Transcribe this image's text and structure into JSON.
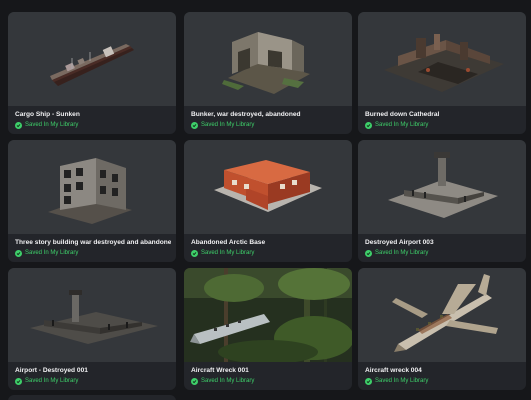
{
  "library": {
    "status_label": "Saved In My Library",
    "status_color": "#3ecf6a",
    "items": [
      {
        "title": "Cargo Ship - Sunken",
        "icon": "cargo-ship-model"
      },
      {
        "title": "Bunker, war destroyed, abandoned",
        "icon": "bunker-ruin-model"
      },
      {
        "title": "Burned down Cathedral",
        "icon": "cathedral-ruin-model"
      },
      {
        "title": "Three story building war destroyed and abandoned",
        "icon": "ruined-building-model"
      },
      {
        "title": "Abandoned Arctic Base",
        "icon": "arctic-base-model"
      },
      {
        "title": "Destroyed Airport 003",
        "icon": "airport-ruin-model"
      },
      {
        "title": "Airport - Destroyed 001",
        "icon": "airport-ruin-model"
      },
      {
        "title": "Aircraft Wreck 001",
        "icon": "aircraft-wreck-photo"
      },
      {
        "title": "Aircraft wreck 004",
        "icon": "aircraft-wreck-model"
      }
    ]
  }
}
